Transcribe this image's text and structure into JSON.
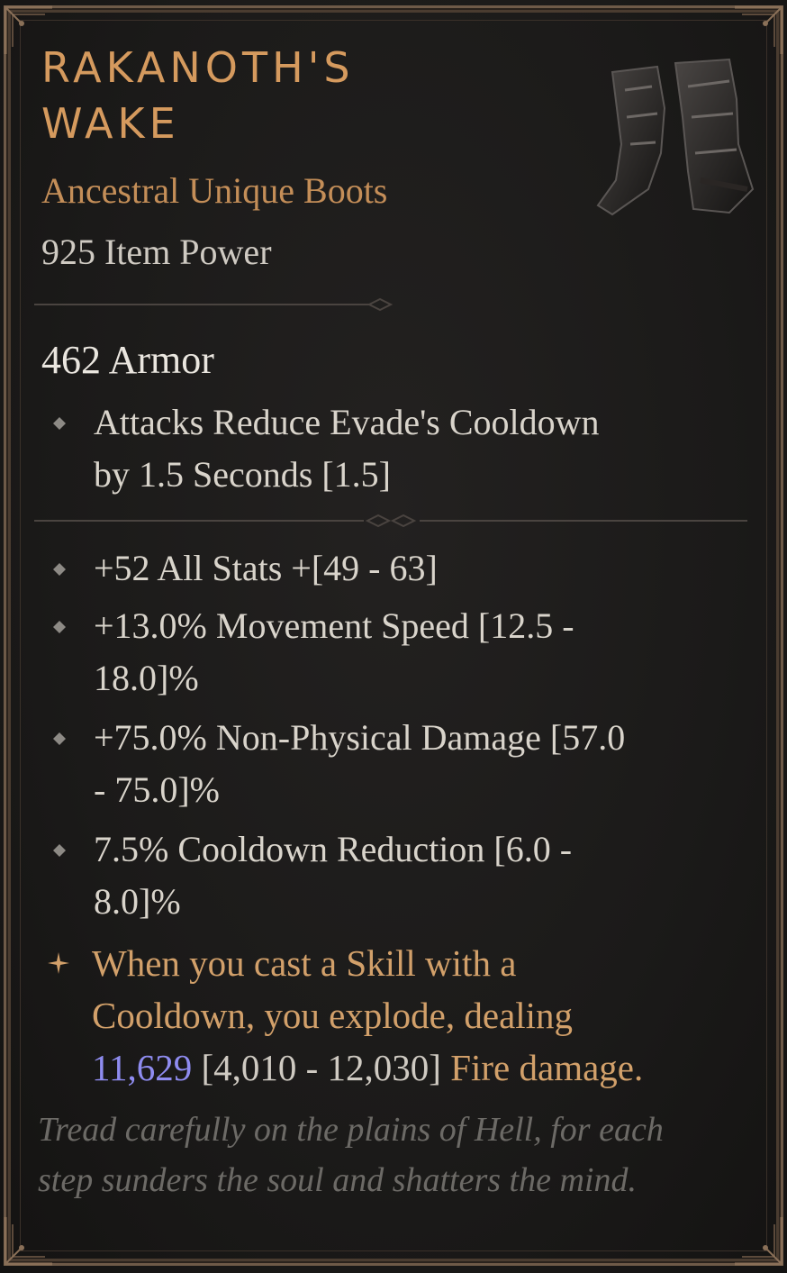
{
  "item": {
    "name_line1": "RAKANOTH'S",
    "name_line2": "WAKE",
    "type": "Ancestral Unique Boots",
    "item_power": "925 Item Power",
    "image_icon": "boots-icon"
  },
  "armor": "462 Armor",
  "implicit": {
    "line1": "Attacks Reduce Evade's Cooldown",
    "line2": "by 1.5 Seconds [1.5]"
  },
  "affixes": [
    {
      "line1": "+52 All Stats +[49 - 63]"
    },
    {
      "line1": "+13.0% Movement Speed [12.5 -",
      "line2": "18.0]%"
    },
    {
      "line1": "+75.0% Non-Physical Damage [57.0",
      "line2": "- 75.0]%"
    },
    {
      "line1": "7.5% Cooldown Reduction [6.0 -",
      "line2": "8.0]%"
    }
  ],
  "unique_power": {
    "line1": "When you cast a Skill with a",
    "line2": "Cooldown, you explode, dealing",
    "value": "11,629",
    "range": "[4,010 - 12,030]",
    "suffix": "Fire damage."
  },
  "flavor": {
    "line1": "Tread carefully on the plains of Hell, for each",
    "line2": "step sunders the soul and shatters the mind."
  },
  "colors": {
    "title": "#d59a5e",
    "subtitle": "#c48e58",
    "unique_text": "#d2a06a",
    "value_blue": "#8f8cf0",
    "flavor": "#6c6a66"
  }
}
